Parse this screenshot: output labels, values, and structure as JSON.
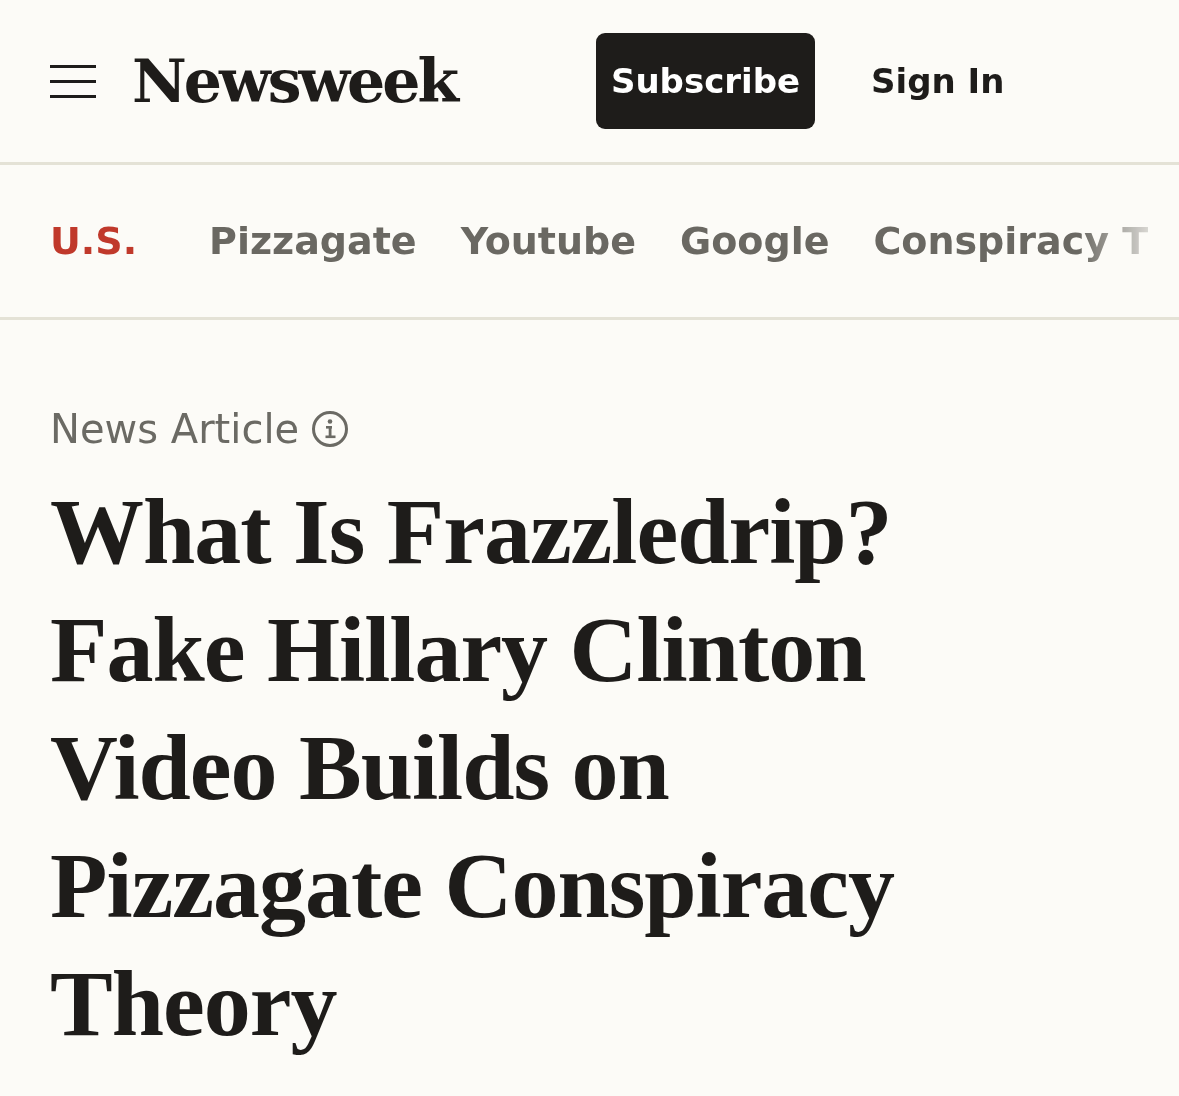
{
  "header": {
    "logo": "Newsweek",
    "subscribe": "Subscribe",
    "sign_in": "Sign In"
  },
  "nav": [
    {
      "label": "U.S.",
      "kind": "section"
    },
    {
      "label": "Pizzagate",
      "kind": "topic"
    },
    {
      "label": "Youtube",
      "kind": "topic"
    },
    {
      "label": "Google",
      "kind": "topic"
    },
    {
      "label": "Conspiracy T",
      "kind": "topic"
    }
  ],
  "article": {
    "label": "News Article",
    "headline": "What Is Frazzledrip? Fake Hillary Clinton Video Builds on Pizzagate Conspiracy Theory"
  }
}
